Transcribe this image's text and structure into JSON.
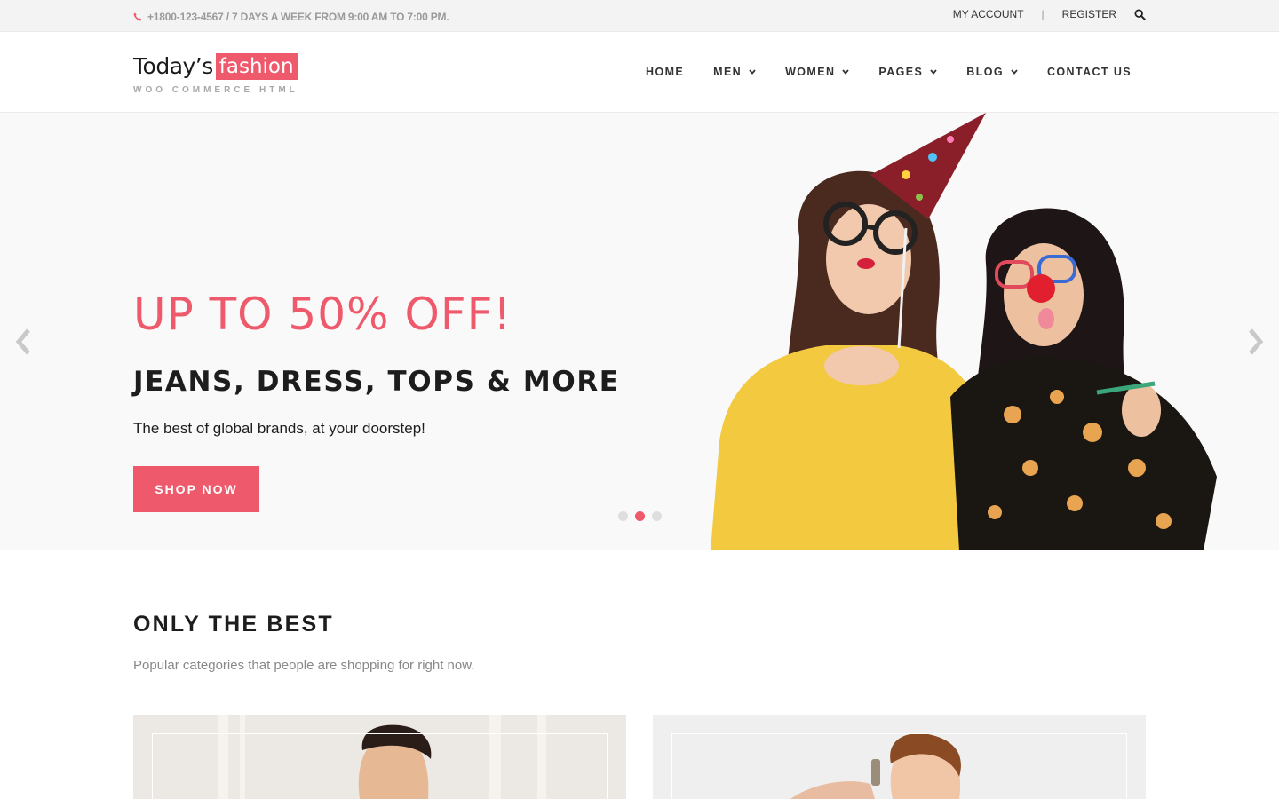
{
  "topbar": {
    "contact_text": "+1800-123-4567 / 7 DAYS A WEEK FROM 9:00 AM TO 7:00 PM.",
    "my_account": "MY ACCOUNT",
    "separator": "|",
    "register": "REGISTER"
  },
  "logo": {
    "today": "Today’s",
    "fashion": "fashion",
    "subtitle": "WOO COMMERCE HTML"
  },
  "nav": {
    "items": [
      {
        "label": "HOME"
      },
      {
        "label": "MEN"
      },
      {
        "label": "WOMEN"
      },
      {
        "label": "PAGES"
      },
      {
        "label": "BLOG"
      },
      {
        "label": "CONTACT US"
      }
    ]
  },
  "hero": {
    "headline": "UP TO 50% OFF!",
    "subheadline": "JEANS, DRESS, TOPS & MORE",
    "tagline": "The best of global brands, at your doorstep!",
    "cta": "SHOP NOW",
    "slides_count": 3,
    "active_slide": 2
  },
  "section": {
    "title": "ONLY THE BEST",
    "description": "Popular categories that people are shopping for right now."
  },
  "colors": {
    "accent": "#ee5a6b",
    "topbar_bg": "#f4f3f3",
    "hero_bg": "#f9f9f9",
    "text_dark": "#1d1d1d"
  },
  "icons": [
    "phone-icon",
    "search-icon",
    "chevron-down-icon",
    "arrow-left-icon",
    "arrow-right-icon"
  ]
}
